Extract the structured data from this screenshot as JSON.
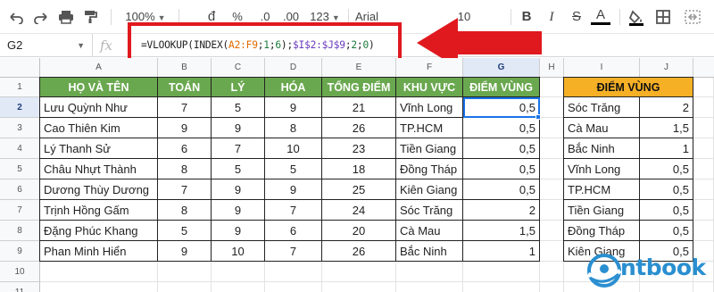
{
  "toolbar": {
    "zoom": "100%",
    "currency": "đ",
    "percent": "%",
    "dec_decrease": ".0",
    "dec_increase": ".00",
    "format_more": "123",
    "font": "Arial",
    "font_size": "10",
    "bold": "B",
    "italic": "I",
    "strike": "S",
    "text_color": "A"
  },
  "formula_bar": {
    "name_box": "G2",
    "fx": "fx",
    "formula_parts": {
      "p1": "=VLOOKUP(INDEX(",
      "ref1": "A2:F9",
      "p2": ";",
      "n1": "1",
      "p3": ";",
      "n2": "6",
      "p4": ");",
      "ref2": "$I$2:$J$9",
      "p5": ";",
      "n3": "2",
      "p6": ";",
      "n4": "0",
      "p7": ")"
    }
  },
  "columns": [
    "A",
    "B",
    "C",
    "D",
    "E",
    "F",
    "G",
    "H",
    "I",
    "J"
  ],
  "rows": [
    "1",
    "2",
    "3",
    "4",
    "5",
    "6",
    "7",
    "8",
    "9",
    "10",
    "11"
  ],
  "main_table": {
    "headers": [
      "HỌ VÀ TÊN",
      "TOÁN",
      "LÝ",
      "HÓA",
      "TỔNG ĐIỂM",
      "KHU VỰC",
      "ĐIỂM VÙNG"
    ],
    "rows": [
      [
        "Lưu Quỳnh Như",
        "7",
        "5",
        "9",
        "21",
        "Vĩnh Long",
        "0,5"
      ],
      [
        "Cao Thiên Kim",
        "9",
        "9",
        "8",
        "26",
        "TP.HCM",
        "0,5"
      ],
      [
        "Lý Thanh Sử",
        "6",
        "7",
        "10",
        "23",
        "Tiền Giang",
        "0,5"
      ],
      [
        "Châu Nhựt Thành",
        "8",
        "5",
        "5",
        "18",
        "Đồng Tháp",
        "0,5"
      ],
      [
        "Dương Thùy Dương",
        "7",
        "9",
        "9",
        "25",
        "Kiên Giang",
        "0,5"
      ],
      [
        "Trịnh Hồng Gấm",
        "8",
        "9",
        "7",
        "24",
        "Sóc Trăng",
        "2"
      ],
      [
        "Đặng Phúc Khang",
        "5",
        "9",
        "6",
        "20",
        "Cà Mau",
        "1,5"
      ],
      [
        "Phan Minh Hiển",
        "9",
        "10",
        "7",
        "26",
        "Bắc Ninh",
        "1"
      ]
    ]
  },
  "lookup_table": {
    "header": "ĐIỂM VÙNG",
    "rows": [
      [
        "Sóc Trăng",
        "2"
      ],
      [
        "Cà Mau",
        "1,5"
      ],
      [
        "Bắc Ninh",
        "1"
      ],
      [
        "Vĩnh Long",
        "0,5"
      ],
      [
        "TP.HCM",
        "0,5"
      ],
      [
        "Tiền Giang",
        "0,5"
      ],
      [
        "Đồng Tháp",
        "0,5"
      ],
      [
        "Kiên Giang",
        "0,5"
      ]
    ]
  },
  "logo": {
    "text": "ntbook"
  },
  "colors": {
    "header_green": "#6aa84f",
    "header_yellow": "#f6b026",
    "highlight_red": "#e0191f",
    "selection_blue": "#1a73e8",
    "logo_blue": "#2a8fd0"
  }
}
